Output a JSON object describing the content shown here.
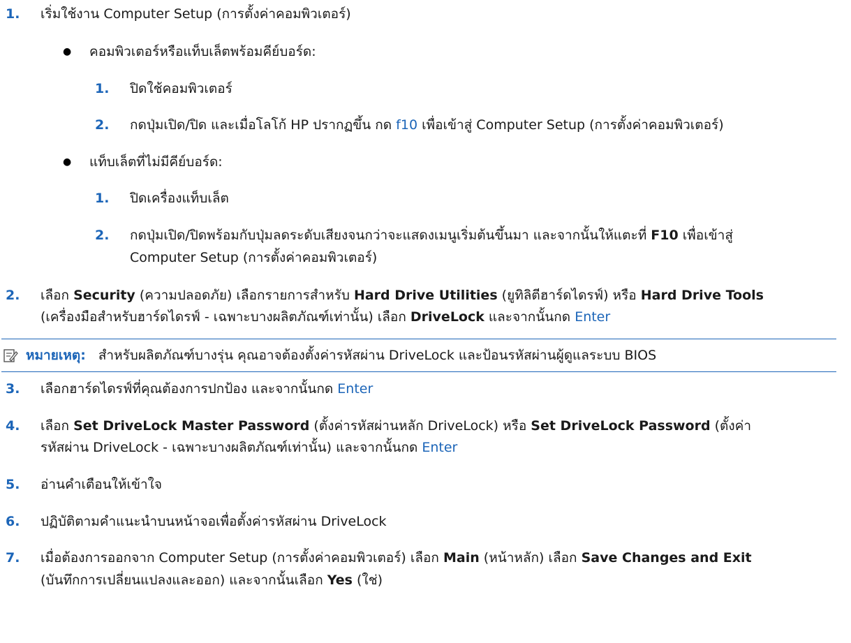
{
  "accent_color": "#1c65b8",
  "steps": {
    "s1": {
      "num": "1.",
      "text": "เริ่มใช้งาน Computer Setup (การตั้งค่าคอมพิวเตอร์)"
    },
    "b1": {
      "text": "คอมพิวเตอร์หรือแท็บเล็ตพร้อมคีย์บอร์ด:"
    },
    "b1_1": {
      "num": "1.",
      "text": "ปิดใช้คอมพิวเตอร์"
    },
    "b1_2": {
      "num": "2.",
      "pre": "กดปุ่มเปิด/ปิด และเมื่อโลโก้ HP ปรากฏขึ้น กด ",
      "key": "f10",
      "post": " เพื่อเข้าสู่ Computer Setup (การตั้งค่าคอมพิวเตอร์)"
    },
    "b2": {
      "text": "แท็บเล็ตที่ไม่มีคีย์บอร์ด:"
    },
    "b2_1": {
      "num": "1.",
      "text": "ปิดเครื่องแท็บเล็ต"
    },
    "b2_2": {
      "num": "2.",
      "pre": "กดปุ่มเปิด/ปิดพร้อมกับปุ่มลดระดับเสียงจนกว่าจะแสดงเมนูเริ่มต้นขึ้นมา และจากนั้นให้แตะที่ ",
      "key_bold": "F10",
      "post": " เพื่อเข้าสู่",
      "line2": "Computer Setup (การตั้งค่าคอมพิวเตอร์)"
    },
    "s2": {
      "num": "2.",
      "t1": "เลือก ",
      "b1": "Security",
      "t2": " (ความปลอดภัย) เลือกรายการสำหรับ ",
      "b2": "Hard Drive Utilities",
      "t3": " (ยูทิลิตีฮาร์ดไดรฟ์) หรือ ",
      "b3": "Hard Drive Tools",
      "t4": "(เครื่องมือสำหรับฮาร์ดไดรฟ์ - เฉพาะบางผลิตภัณฑ์เท่านั้น) เลือก ",
      "b4": "DriveLock",
      "t5": " และจากนั้นกด ",
      "key": "Enter"
    },
    "note": {
      "label": "หมายเหตุ:",
      "text": "สำหรับผลิตภัณฑ์บางรุ่น คุณอาจต้องตั้งค่ารหัสผ่าน DriveLock และป้อนรหัสผ่านผู้ดูแลระบบ BIOS"
    },
    "s3": {
      "num": "3.",
      "text": "เลือกฮาร์ดไดรฟ์ที่คุณต้องการปกป้อง และจากนั้นกด ",
      "key": "Enter"
    },
    "s4": {
      "num": "4.",
      "t1": "เลือก ",
      "b1": "Set DriveLock Master Password",
      "t2": " (ตั้งค่ารหัสผ่านหลัก DriveLock) หรือ ",
      "b2": "Set DriveLock Password",
      "t3": " (ตั้งค่า",
      "t4": "รหัสผ่าน DriveLock - เฉพาะบางผลิตภัณฑ์เท่านั้น) และจากนั้นกด ",
      "key": "Enter"
    },
    "s5": {
      "num": "5.",
      "text": "อ่านคำเตือนให้เข้าใจ"
    },
    "s6": {
      "num": "6.",
      "text": "ปฏิบัติตามคำแนะนำบนหน้าจอเพื่อตั้งค่ารหัสผ่าน DriveLock"
    },
    "s7": {
      "num": "7.",
      "t1": "เมื่อต้องการออกจาก Computer Setup (การตั้งค่าคอมพิวเตอร์) เลือก ",
      "b1": "Main",
      "t2": " (หน้าหลัก) เลือก ",
      "b2": "Save Changes and Exit",
      "t3": "(บันทึกการเปลี่ยนแปลงและออก) และจากนั้นเลือก ",
      "b3": "Yes",
      "t4": " (ใช่)"
    }
  }
}
